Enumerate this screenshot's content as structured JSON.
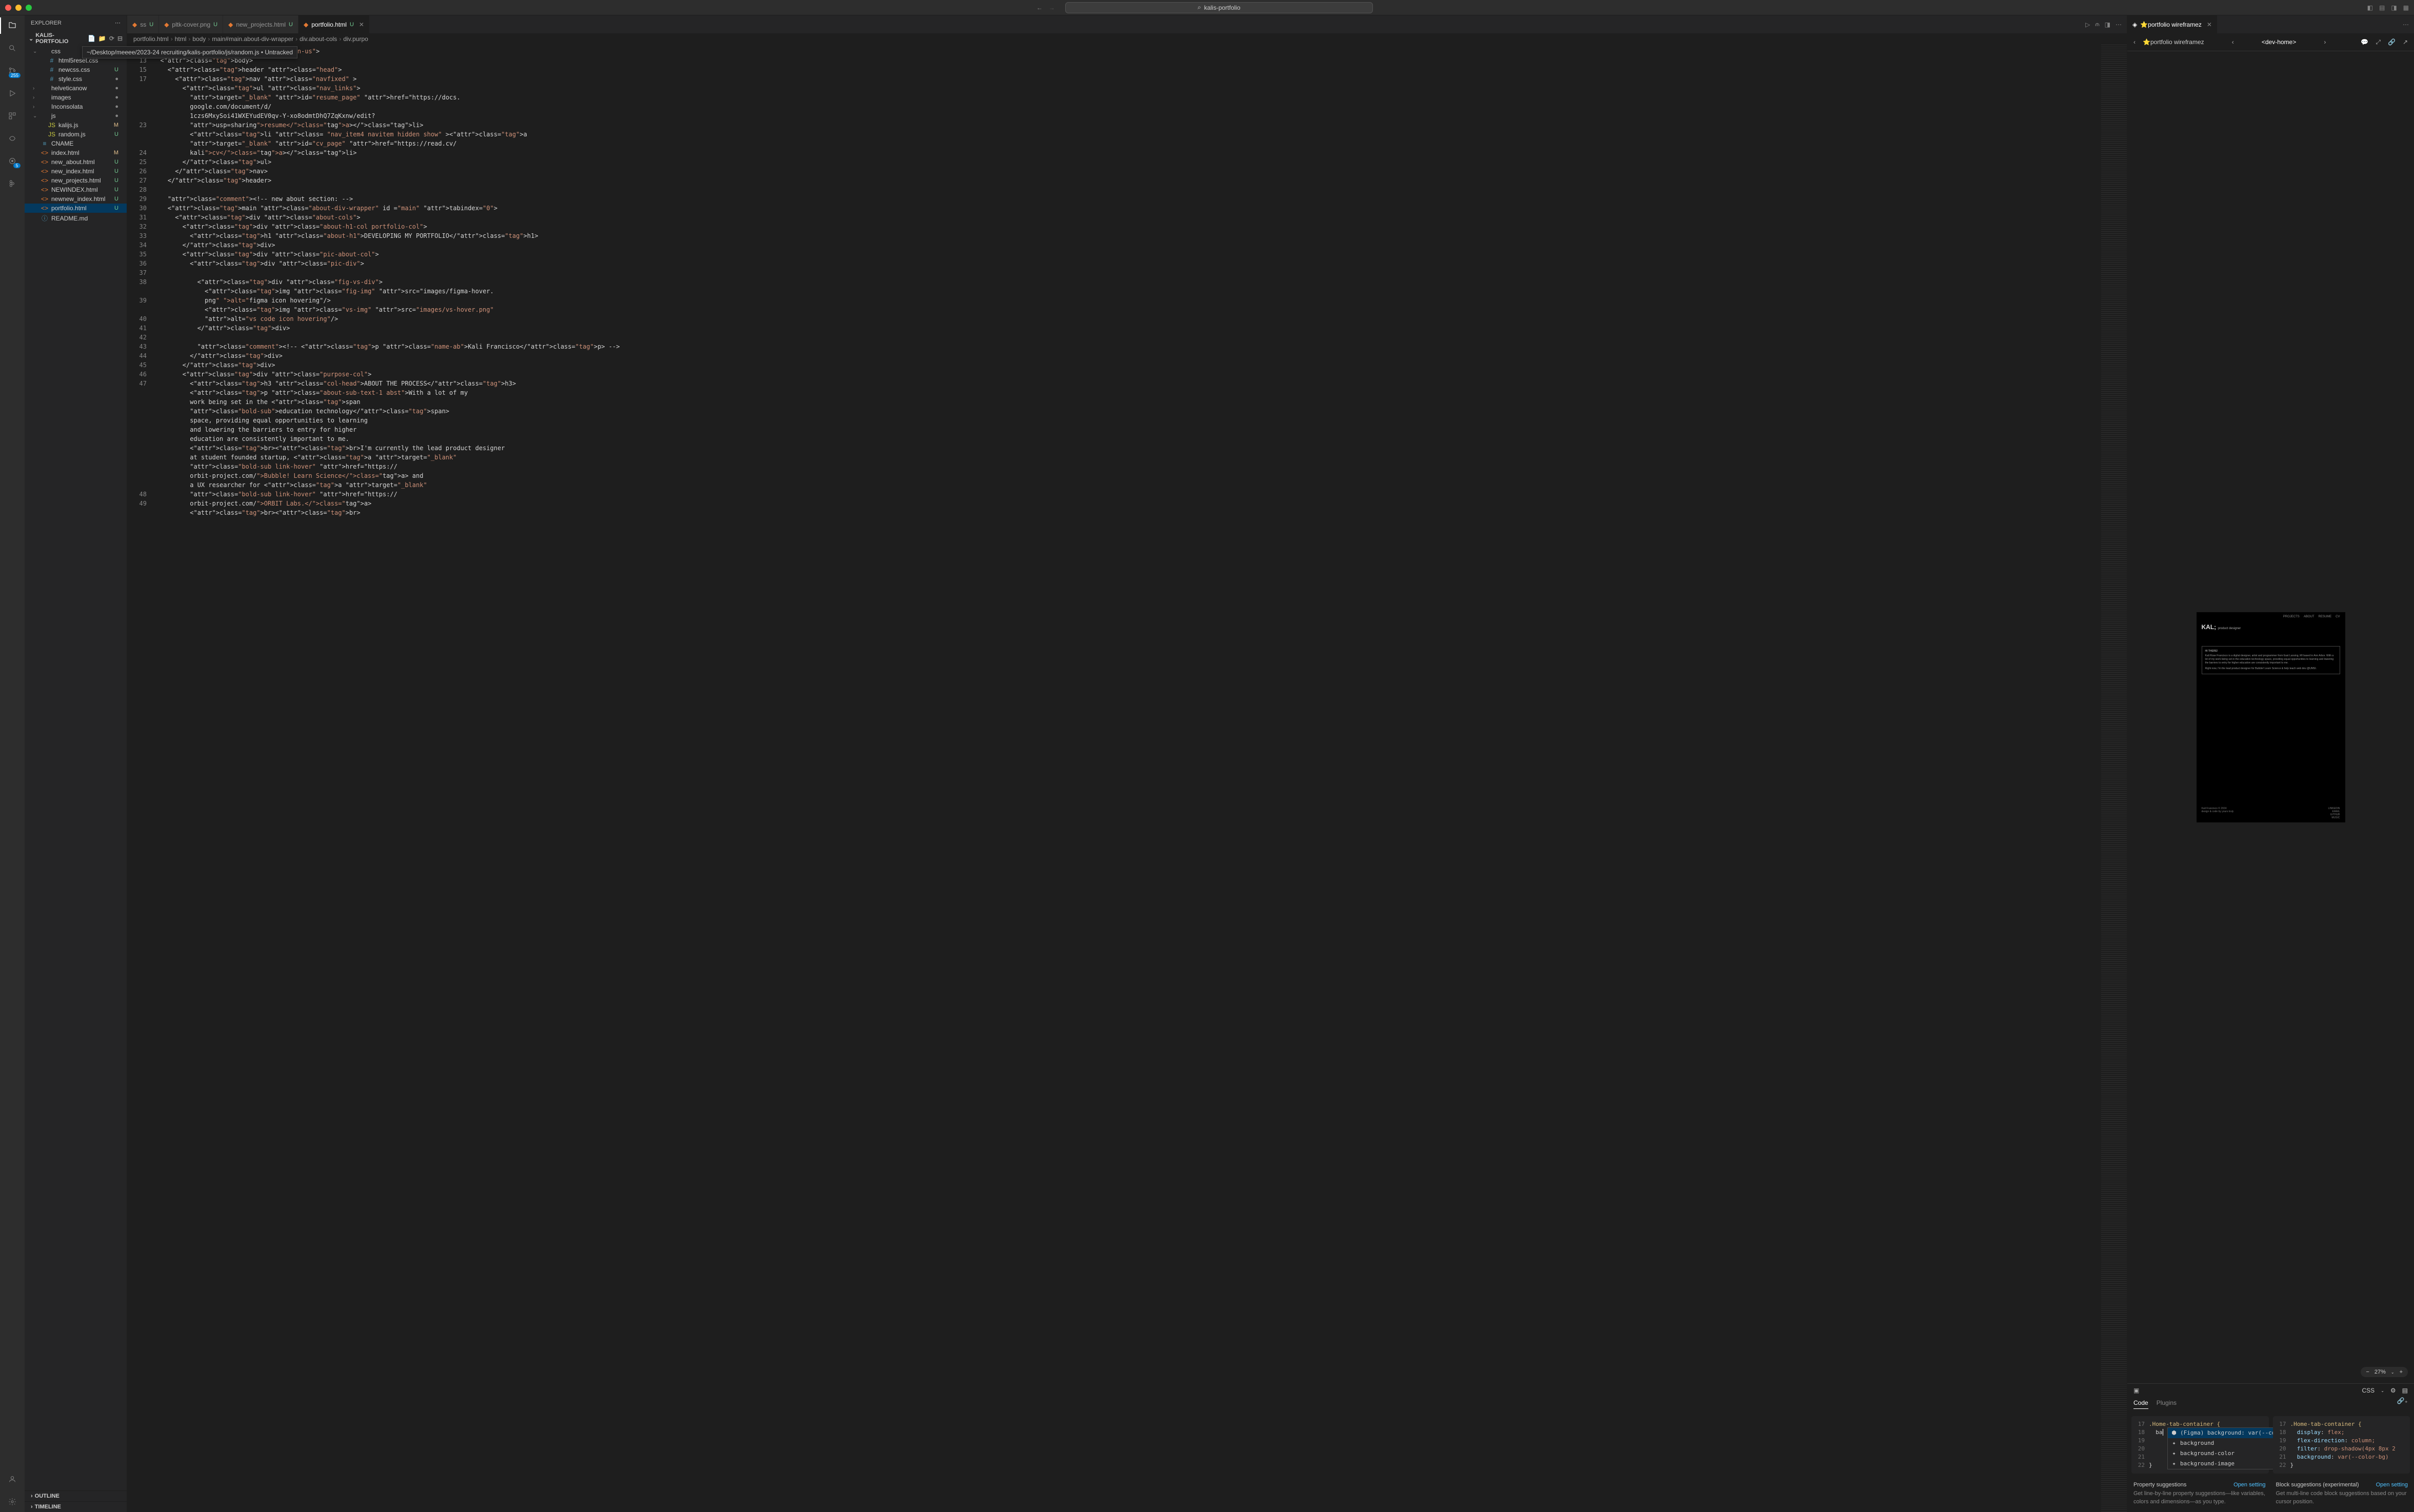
{
  "titlebar": {
    "search_text": "kalis-portfolio"
  },
  "activity": {
    "scm_badge": "255",
    "testing_badge": "5"
  },
  "sidebar": {
    "header": "EXPLORER",
    "project": "KALIS-PORTFOLIO",
    "tree": [
      {
        "type": "folder",
        "name": "css",
        "indent": 0,
        "expanded": true
      },
      {
        "type": "file",
        "name": "html5reset.css",
        "indent": 1,
        "icon": "#",
        "status": ""
      },
      {
        "type": "file",
        "name": "newcss.css",
        "indent": 1,
        "icon": "#",
        "status": "U"
      },
      {
        "type": "file",
        "name": "style.css",
        "indent": 1,
        "icon": "#",
        "status": "•"
      },
      {
        "type": "folder",
        "name": "helveticanow",
        "indent": 0,
        "status": "•"
      },
      {
        "type": "folder",
        "name": "images",
        "indent": 0,
        "status": "•"
      },
      {
        "type": "folder",
        "name": "Inconsolata",
        "indent": 0,
        "status": "•"
      },
      {
        "type": "folder",
        "name": "js",
        "indent": 0,
        "expanded": true,
        "status": "•"
      },
      {
        "type": "file",
        "name": "kalijs.js",
        "indent": 1,
        "icon": "JS",
        "status": "M"
      },
      {
        "type": "file",
        "name": "random.js",
        "indent": 1,
        "icon": "JS",
        "status": "U"
      },
      {
        "type": "file",
        "name": "CNAME",
        "indent": 0,
        "icon": "≡"
      },
      {
        "type": "file",
        "name": "index.html",
        "indent": 0,
        "icon": "<>",
        "status": "M"
      },
      {
        "type": "file",
        "name": "new_about.html",
        "indent": 0,
        "icon": "<>",
        "status": "U"
      },
      {
        "type": "file",
        "name": "new_index.html",
        "indent": 0,
        "icon": "<>",
        "status": "U"
      },
      {
        "type": "file",
        "name": "new_projects.html",
        "indent": 0,
        "icon": "<>",
        "status": "U"
      },
      {
        "type": "file",
        "name": "NEWINDEX.html",
        "indent": 0,
        "icon": "<>",
        "status": "U"
      },
      {
        "type": "file",
        "name": "newnew_index.html",
        "indent": 0,
        "icon": "<>",
        "status": "U"
      },
      {
        "type": "file",
        "name": "portfolio.html",
        "indent": 0,
        "icon": "<>",
        "status": "U",
        "selected": true
      },
      {
        "type": "file",
        "name": "README.md",
        "indent": 0,
        "icon": "ⓘ"
      }
    ],
    "outline": "OUTLINE",
    "timeline": "TIMELINE"
  },
  "tooltip": "~/Desktop/meeee/2023-24 recruiting/kalis-portfolio/js/random.js • Untracked",
  "tabs": {
    "items": [
      {
        "label": "ss",
        "status": "U"
      },
      {
        "label": "pltk-cover.png",
        "status": "U"
      },
      {
        "label": "new_projects.html",
        "status": "U"
      },
      {
        "label": "portfolio.html",
        "status": "U",
        "active": true,
        "close": true
      }
    ]
  },
  "breadcrumb": [
    "portfolio.html",
    "html",
    "body",
    "main#main.about-div-wrapper",
    "div.about-cols",
    "div.purpo"
  ],
  "line_numbers": [
    "2",
    "13",
    "15",
    "17",
    "",
    "",
    "",
    "",
    "23",
    "",
    "",
    "24",
    "25",
    "26",
    "27",
    "28",
    "29",
    "30",
    "31",
    "32",
    "33",
    "34",
    "35",
    "36",
    "37",
    "38",
    "",
    "39",
    "",
    "40",
    "41",
    "42",
    "43",
    "44",
    "45",
    "46",
    "47",
    "",
    "",
    "",
    "",
    "",
    "",
    "",
    "",
    "",
    "",
    "",
    "48",
    "49"
  ],
  "code_lines": [
    "<html lang=\"en-us\">",
    "  <body>",
    "    <header class=\"head\">",
    "      <nav class=\"navfixed\" >",
    "        <ul class=\"nav_links\">",
    "          target=\"_blank\" id=\"resume_page\" href=\"https://docs.",
    "          google.com/document/d/",
    "          1czs6MxySoi41WXEYudEV0qv-Y-xo8odmtDhQ7ZqKxnw/edit?",
    "          usp=sharing\">resume</a></li>",
    "          <li class= \"nav_item4 navitem hidden show\" ><a",
    "          target=\"_blank\" id=\"cv_page\" href=\"https://read.cv/",
    "          kali\">cv</a></li>",
    "        </ul>",
    "      </nav>",
    "    </header>",
    "",
    "    <!-- new about section: -->",
    "    <main class=\"about-div-wrapper\" id =\"main\" tabindex=\"0\">",
    "      <div class=\"about-cols\">",
    "        <div class=\"about-h1-col portfolio-col\">",
    "          <h1 class=\"about-h1\">DEVELOPING MY PORTFOLIO</h1>",
    "        </div>",
    "        <div class=\"pic-about-col\">",
    "          <div class=\"pic-div\">",
    "",
    "            <div class=\"fig-vs-div\">",
    "              <img class=\"fig-img\" src=\"images/figma-hover.",
    "              png\" alt=\"figma icon hovering\"/>",
    "              <img class=\"vs-img\" src=\"images/vs-hover.png\"",
    "              alt=\"vs code icon hovering\"/>",
    "            </div>",
    "",
    "            <!-- <p class=\"name-ab\">Kali Francisco</p> -->",
    "          </div>",
    "        </div>",
    "        <div class=\"purpose-col\">",
    "          <h3 class=\"col-head\">ABOUT THE PROCESS</h3>",
    "          <p class=\"about-sub-text-1 abst\">With a lot of my",
    "          work being set in the <span",
    "          class=\"bold-sub\">education technology</span>",
    "          space, providing equal opportunities to learning",
    "          and lowering the barriers to entry for higher",
    "          education are consistently important to me.",
    "          <br><br>I'm currently the lead product designer",
    "          at student founded startup, <a target=\"_blank\"",
    "          class=\"bold-sub link-hover\" href=\"https://",
    "          orbit-project.com/\">Bubble! Learn Science</a> and",
    "          a UX researcher for <a target=\"_blank\"",
    "          class=\"bold-sub link-hover\" href=\"https://",
    "          orbit-project.com/\">ORBIT Labs.</a>",
    "          <br><br>"
  ],
  "right_tab": "⭐portfolio wireframez",
  "figma": {
    "doc_name": "⭐portfolio wireframez",
    "frame_name": "<dev-home>",
    "zoom": "27%",
    "preview": {
      "nav": [
        "PROJECTS",
        "ABOUT",
        "RESUME",
        "CV"
      ],
      "logo_main": "KAL;",
      "logo_sub": "product designer",
      "box_head": "HI THERE!",
      "box_body": "Kali Rose Francisco is a digital designer, artist and programmer from East Lansing, MI based in Ann Arbor. With a lot of my work being set in the education technology space, providing equal opportunities to learning and lowering the barriers to entry for higher education are consistently important to me.",
      "box_body2": "Right now, I'm the lead product designer for Bubble! Learn Science & help teach web dev @UMSI.",
      "footer_left": "Kali Francisco © 2024",
      "footer_left2": "design & code by yours truly",
      "footer_links": [
        "LINKEDIN",
        "EMAIL",
        "GITHUB",
        "MUSIC"
      ]
    },
    "css_label": "CSS",
    "tabs": {
      "code": "Code",
      "plugins": "Plugins"
    },
    "left_panel": {
      "lines": [
        "17",
        "18",
        "19",
        "20",
        "21",
        "22"
      ],
      "selector": ".Home-tab-container {",
      "typed": "  ba",
      "close": "}",
      "suggestions": [
        {
          "icon": "⬢",
          "label": "(Figma) background: var(--co",
          "selected": true
        },
        {
          "icon": "✦",
          "label": "background"
        },
        {
          "icon": "✦",
          "label": "background-color"
        },
        {
          "icon": "✦",
          "label": "background-image"
        }
      ]
    },
    "right_panel": {
      "lines": [
        "17",
        "18",
        "19",
        "20",
        "21",
        "22"
      ],
      "code": [
        ".Home-tab-container {",
        "  display: flex;",
        "  flex-direction: column;",
        "  filter: drop-shadow(4px 8px 2",
        "  background: var(--color-bg)",
        "}"
      ]
    },
    "footer": {
      "prop_head": "Property suggestions",
      "prop_setting": "Open setting",
      "prop_desc": "Get line-by-line property suggestions—like variables, colors and dimensions—as you type.",
      "block_head": "Block suggestions (experimental)",
      "block_setting": "Open setting",
      "block_desc": "Get multi-line code block suggestions based on your cursor position."
    }
  }
}
